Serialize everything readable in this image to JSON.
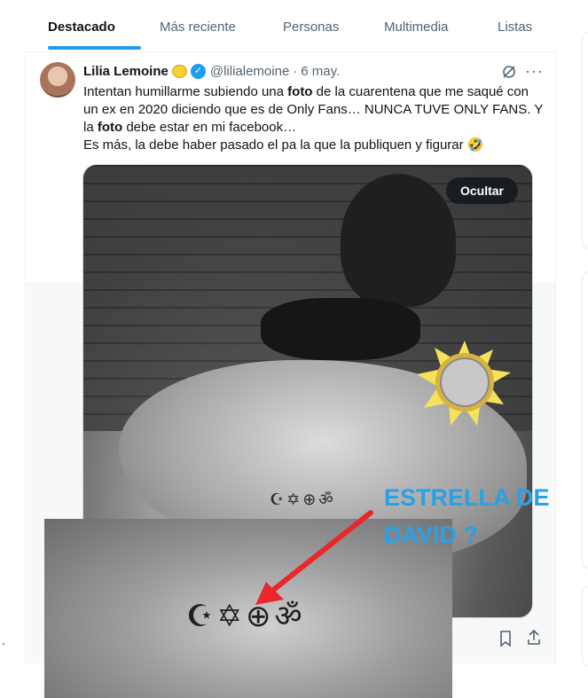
{
  "tabs": [
    "Destacado",
    "Más reciente",
    "Personas",
    "Multimedia",
    "Listas"
  ],
  "tweet": {
    "author_name": "Lilia Lemoine",
    "handle": "@lilialemoine",
    "separator": "·",
    "date": "6 may.",
    "text_parts": {
      "l1_a": "Intentan humillarme subiendo una ",
      "l1_b": "foto",
      "l1_c": " de la cuarentena que me saqué con un ex en 2020 diciendo que es de Only Fans… NUNCA TUVE ONLY FANS. Y la ",
      "l1_d": "foto",
      "l1_e": " debe estar en mi facebook…",
      "l2": "Es más, la debe haber pasado el pa la que la publiquen y figurar",
      "l2_emoji": "🤣"
    },
    "hide_button": "Ocultar",
    "more_icon": "···"
  },
  "annotation": {
    "line1": "ESTRELLA DE",
    "line2": "DAVID ?",
    "color": "#2aa0e6",
    "arrow_color": "#e8282b"
  },
  "stray_mark": ".",
  "colors": {
    "accent": "#1d9bf0",
    "text": "#0f1419",
    "muted": "#536471"
  }
}
